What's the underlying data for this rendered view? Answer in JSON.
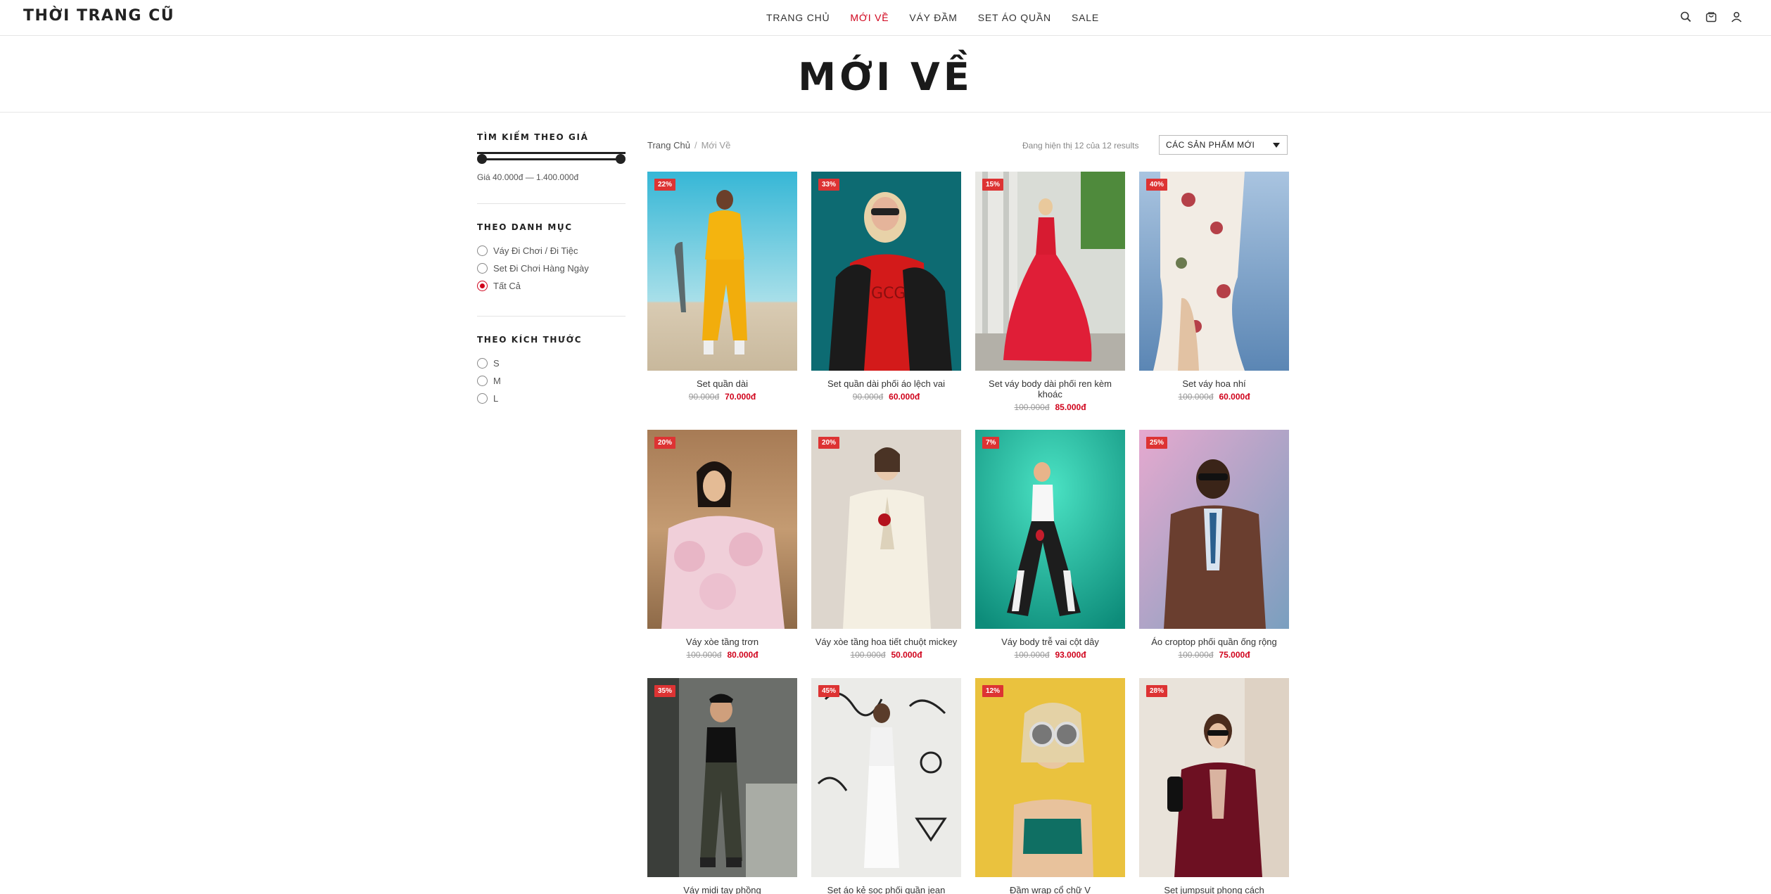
{
  "header": {
    "logo": "THỜI TRANG CŨ",
    "nav": [
      {
        "label": "TRANG CHỦ",
        "active": false
      },
      {
        "label": "MỚI VỀ",
        "active": true
      },
      {
        "label": "VÁY ĐẦM",
        "active": false
      },
      {
        "label": "SET ÁO QUẦN",
        "active": false
      },
      {
        "label": "SALE",
        "active": false
      }
    ],
    "icons": [
      "search-icon",
      "cart-icon",
      "user-icon"
    ]
  },
  "page_title": "MỚI VỀ",
  "sidebar": {
    "price": {
      "heading": "TÌM KIẾM THEO GIÁ",
      "range_text": "Giá 40.000đ — 1.400.000đ"
    },
    "category": {
      "heading": "THEO DANH MỤC",
      "items": [
        {
          "label": "Váy Đi Chơi / Đi Tiệc",
          "checked": false
        },
        {
          "label": "Set Đi Chơi Hàng Ngày",
          "checked": false
        },
        {
          "label": "Tất Cả",
          "checked": true
        }
      ]
    },
    "size": {
      "heading": "THEO KÍCH THƯỚC",
      "items": [
        {
          "label": "S",
          "checked": false
        },
        {
          "label": "M",
          "checked": false
        },
        {
          "label": "L",
          "checked": false
        }
      ]
    }
  },
  "breadcrumb": {
    "home": "Trang Chủ",
    "separator": "/",
    "current": "Mới Về"
  },
  "result_count": "Đang hiện thị 12 của 12 results",
  "sort": {
    "selected": "CÁC SẢN PHẨM MỚI"
  },
  "accent_color": "#d0021b",
  "products": [
    {
      "name": "Set quần dài",
      "old_price": "90.000đ",
      "new_price": "70.000đ",
      "badge": "22%"
    },
    {
      "name": "Set quần dài phối áo lệch vai",
      "old_price": "90.000đ",
      "new_price": "60.000đ",
      "badge": "33%"
    },
    {
      "name": "Set váy body dài phối ren kèm khoác",
      "old_price": "100.000đ",
      "new_price": "85.000đ",
      "badge": "15%"
    },
    {
      "name": "Set váy hoa nhí",
      "old_price": "100.000đ",
      "new_price": "60.000đ",
      "badge": "40%"
    },
    {
      "name": "Váy xòe tầng trơn",
      "old_price": "100.000đ",
      "new_price": "80.000đ",
      "badge": "20%"
    },
    {
      "name": "Váy xòe tầng hoa tiết chuột mickey",
      "old_price": "100.000đ",
      "new_price": "50.000đ",
      "badge": "20%"
    },
    {
      "name": "Váy body trễ vai cột dây",
      "old_price": "100.000đ",
      "new_price": "93.000đ",
      "badge": "7%"
    },
    {
      "name": "Áo croptop phối quần ống rộng",
      "old_price": "100.000đ",
      "new_price": "75.000đ",
      "badge": "25%"
    },
    {
      "name": "Váy midi tay phồng",
      "old_price": "",
      "new_price": "",
      "badge": "35%"
    },
    {
      "name": "Set áo kẻ sọc phối quần jean",
      "old_price": "",
      "new_price": "",
      "badge": "45%"
    },
    {
      "name": "Đầm wrap cổ chữ V",
      "old_price": "",
      "new_price": "",
      "badge": "12%"
    },
    {
      "name": "Set jumpsuit phong cách",
      "old_price": "",
      "new_price": "",
      "badge": "28%"
    }
  ]
}
